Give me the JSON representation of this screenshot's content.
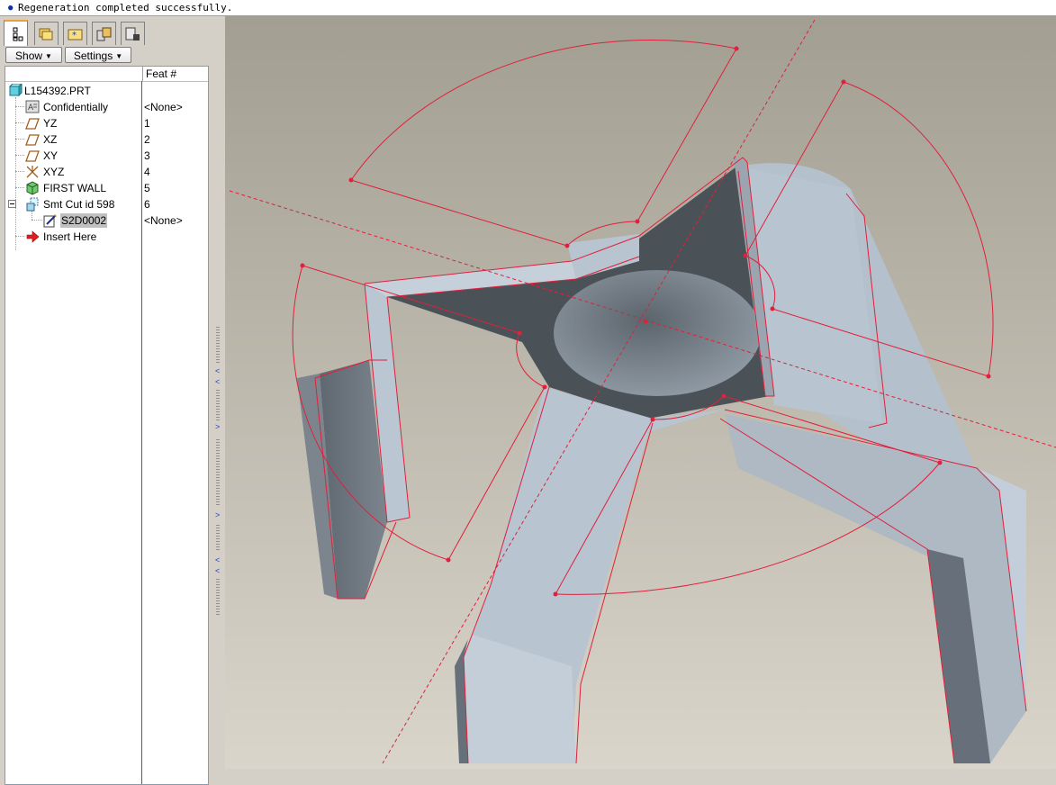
{
  "status": {
    "message": "Regeneration completed successfully."
  },
  "tabs": [
    {
      "name": "model-tree-tab",
      "icon": "tree-icon",
      "active": true
    },
    {
      "name": "folder-browser-tab",
      "icon": "folder-icon",
      "active": false
    },
    {
      "name": "favorites-tab",
      "icon": "favorites-icon",
      "active": false
    },
    {
      "name": "history-tab",
      "icon": "history-icon",
      "active": false
    },
    {
      "name": "connections-tab",
      "icon": "connections-icon",
      "active": false
    }
  ],
  "toolbar": {
    "show_label": "Show",
    "settings_label": "Settings"
  },
  "tree": {
    "column_header": "Feat #",
    "items": [
      {
        "label": "L154392.PRT",
        "feat": "",
        "icon": "part-icon"
      },
      {
        "label": "Confidentially",
        "feat": "<None>",
        "icon": "note-icon"
      },
      {
        "label": "YZ",
        "feat": "1",
        "icon": "datum-plane-icon"
      },
      {
        "label": "XZ",
        "feat": "2",
        "icon": "datum-plane-icon"
      },
      {
        "label": "XY",
        "feat": "3",
        "icon": "datum-plane-icon"
      },
      {
        "label": "XYZ",
        "feat": "4",
        "icon": "coordinate-system-icon"
      },
      {
        "label": "FIRST WALL",
        "feat": "5",
        "icon": "sheetmetal-wall-icon"
      },
      {
        "label": "Smt Cut id 598",
        "feat": "6",
        "icon": "cut-icon"
      },
      {
        "label": "S2D0002",
        "feat": "<None>",
        "icon": "sketch-icon"
      },
      {
        "label": "Insert Here",
        "feat": "",
        "icon": "insert-arrow-icon"
      }
    ]
  },
  "colors": {
    "accent_tab": "#e8a040",
    "tree_divider": "#3060c0",
    "sketch_lines": "#e0203c",
    "part_surface": "#b8c4d0",
    "viewport_top": "#a29e92",
    "viewport_bottom": "#d9d5ca"
  }
}
